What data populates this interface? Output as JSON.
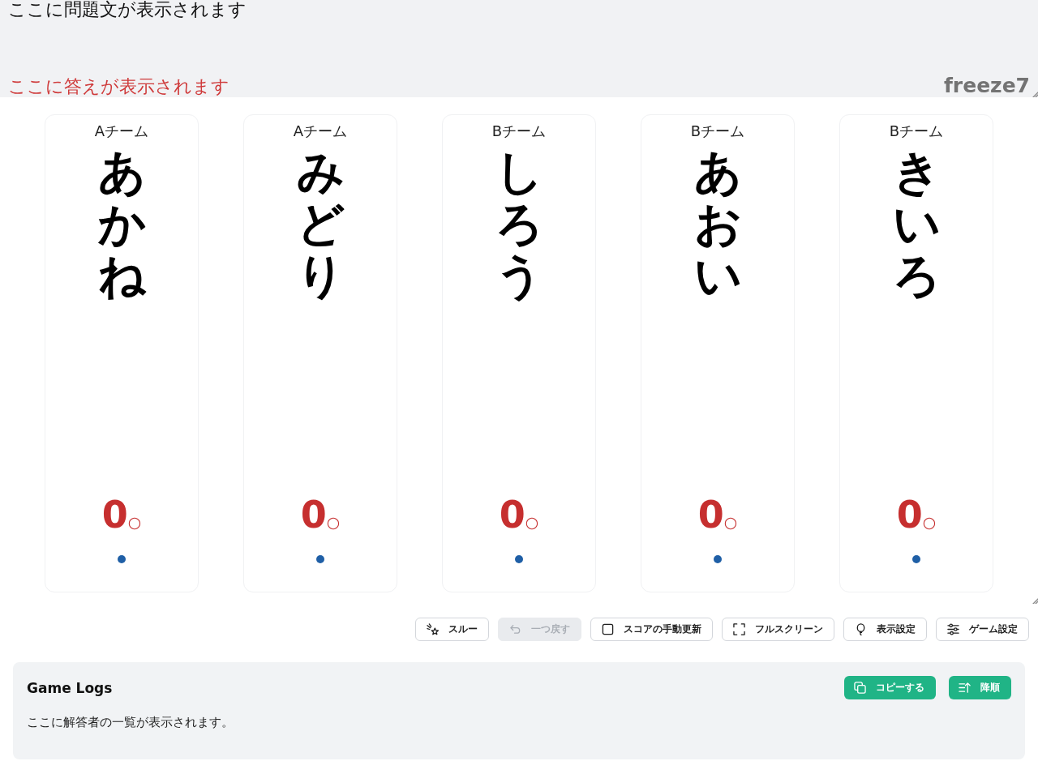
{
  "question": {
    "text": "ここに問題文が表示されます"
  },
  "answer": {
    "text": "ここに答えが表示されます"
  },
  "rule_name": "freeze7",
  "players": [
    {
      "team": "Aチーム",
      "name": "あかね",
      "score": "0",
      "score_mark": "○"
    },
    {
      "team": "Aチーム",
      "name": "みどり",
      "score": "0",
      "score_mark": "○"
    },
    {
      "team": "Bチーム",
      "name": "しろう",
      "score": "0",
      "score_mark": "○"
    },
    {
      "team": "Bチーム",
      "name": "あおい",
      "score": "0",
      "score_mark": "○"
    },
    {
      "team": "Bチーム",
      "name": "きいろ",
      "score": "0",
      "score_mark": "○"
    }
  ],
  "toolbar": [
    {
      "label": "スルー",
      "disabled": false
    },
    {
      "label": "一つ戻す",
      "disabled": true
    },
    {
      "label": "スコアの手動更新",
      "disabled": false
    },
    {
      "label": "フルスクリーン",
      "disabled": false
    },
    {
      "label": "表示設定",
      "disabled": false
    },
    {
      "label": "ゲーム設定",
      "disabled": false
    }
  ],
  "game_logs": {
    "title": "Game Logs",
    "buttons": [
      {
        "label": "コピーする"
      },
      {
        "label": "降順"
      }
    ],
    "empty_text": "ここに解答者の一覧が表示されます。"
  }
}
